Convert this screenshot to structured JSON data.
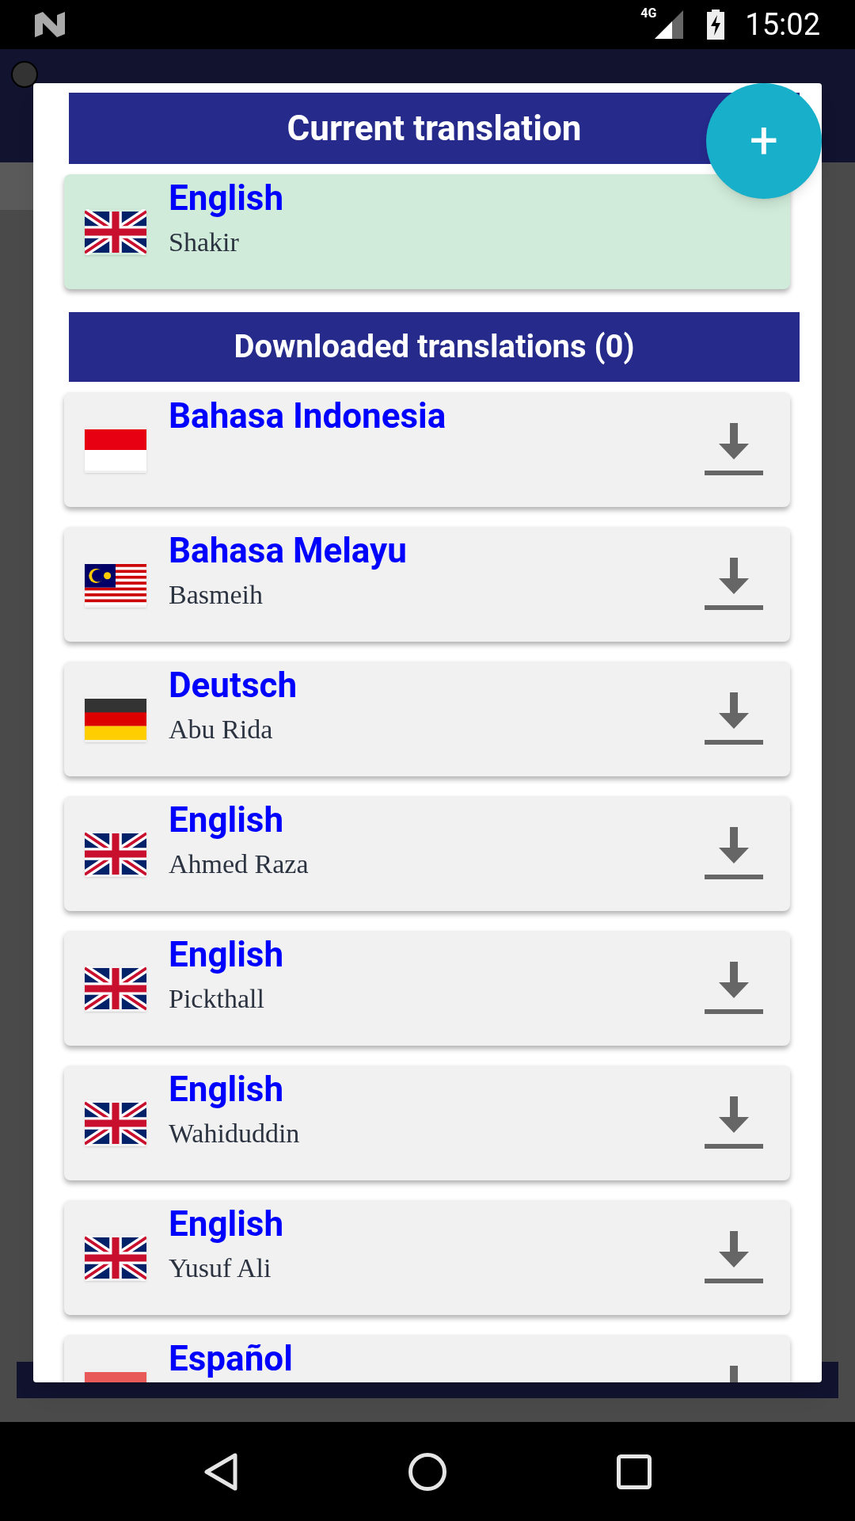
{
  "status_bar": {
    "network": "4G",
    "time": "15:02"
  },
  "dialog": {
    "current_header": "Current translation",
    "current": {
      "language": "English",
      "translator": "Shakir",
      "kind": "uk"
    },
    "downloaded_header": "Downloaded translations (0)",
    "items": [
      {
        "language": "Bahasa Indonesia",
        "kind": "id"
      },
      {
        "language": "Bahasa Melayu",
        "translator": "Basmeih",
        "kind": "my"
      },
      {
        "language": "Deutsch",
        "translator": "Abu Rida",
        "kind": "de"
      },
      {
        "language": "English",
        "translator": "Ahmed Raza",
        "kind": "uk"
      },
      {
        "language": "English",
        "translator": "Pickthall",
        "kind": "uk"
      },
      {
        "language": "English",
        "translator": "Wahiduddin",
        "kind": "uk"
      },
      {
        "language": "English",
        "translator": "Yusuf Ali",
        "kind": "uk"
      },
      {
        "language": "Español",
        "kind": "es"
      }
    ],
    "add_button": "+"
  }
}
